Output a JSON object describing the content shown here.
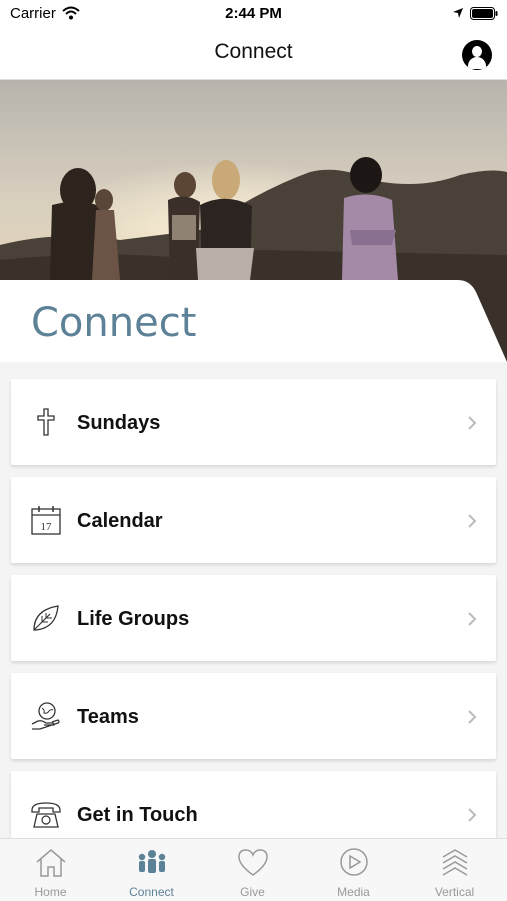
{
  "status_bar": {
    "carrier": "Carrier",
    "time": "2:44 PM"
  },
  "nav": {
    "title": "Connect"
  },
  "page": {
    "heading": "Connect"
  },
  "menu": [
    {
      "label": "Sundays",
      "icon": "cross-icon"
    },
    {
      "label": "Calendar",
      "icon": "calendar-icon",
      "calendar_day": "17"
    },
    {
      "label": "Life Groups",
      "icon": "leaf-icon"
    },
    {
      "label": "Teams",
      "icon": "hand-globe-icon"
    },
    {
      "label": "Get in Touch",
      "icon": "telephone-icon"
    }
  ],
  "tabbar": {
    "active": "Connect",
    "tabs": [
      {
        "label": "Home",
        "icon": "home-icon"
      },
      {
        "label": "Connect",
        "icon": "people-icon"
      },
      {
        "label": "Give",
        "icon": "heart-icon"
      },
      {
        "label": "Media",
        "icon": "play-circle-icon"
      },
      {
        "label": "Vertical",
        "icon": "chevrons-up-icon"
      }
    ]
  },
  "colors": {
    "accent": "#5d8196",
    "inactive": "#999999"
  }
}
